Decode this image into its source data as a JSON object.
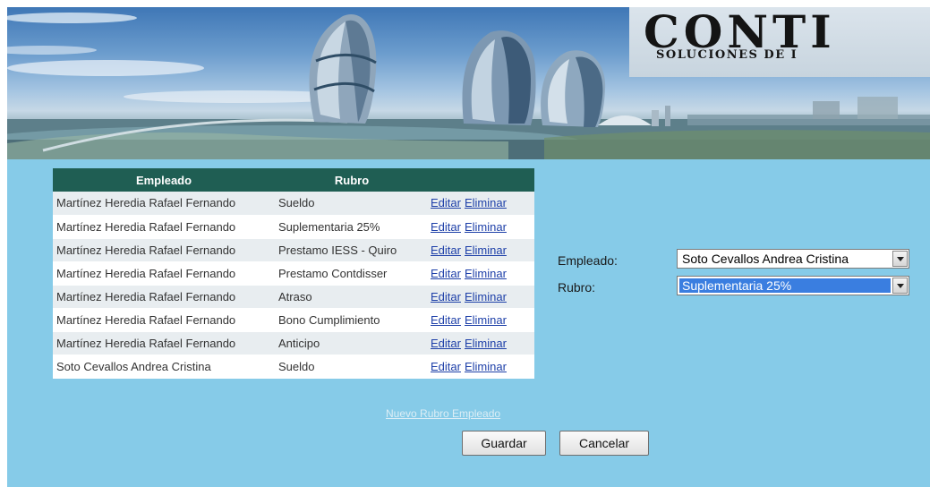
{
  "banner": {
    "logo_word": "CONTI",
    "logo_sub": "SOLUCIONES DE I"
  },
  "grid": {
    "headers": [
      "Empleado",
      "Rubro",
      ""
    ],
    "action_labels": {
      "edit": "Editar",
      "delete": "Eliminar"
    },
    "rows": [
      {
        "empleado": "Martínez Heredia Rafael Fernando",
        "rubro": "Sueldo"
      },
      {
        "empleado": "Martínez Heredia Rafael Fernando",
        "rubro": "Suplementaria 25%"
      },
      {
        "empleado": "Martínez Heredia Rafael Fernando",
        "rubro": "Prestamo IESS - Quiro"
      },
      {
        "empleado": "Martínez Heredia Rafael Fernando",
        "rubro": "Prestamo Contdisser"
      },
      {
        "empleado": "Martínez Heredia Rafael Fernando",
        "rubro": "Atraso"
      },
      {
        "empleado": "Martínez Heredia Rafael Fernando",
        "rubro": "Bono Cumplimiento"
      },
      {
        "empleado": "Martínez Heredia Rafael Fernando",
        "rubro": "Anticipo"
      },
      {
        "empleado": "Soto Cevallos Andrea Cristina",
        "rubro": "Sueldo"
      }
    ],
    "new_link": "Nuevo Rubro Empleado"
  },
  "buttons": {
    "save": "Guardar",
    "cancel": "Cancelar"
  },
  "form": {
    "empleado_label": "Empleado:",
    "empleado_value": "Soto Cevallos Andrea Cristina",
    "rubro_label": "Rubro:",
    "rubro_value": "Suplementaria 25%"
  },
  "colors": {
    "page_background": "#86cbe8",
    "grid_header": "#1f5e53",
    "link": "#1d3fa8",
    "selected_highlight": "#3a7ee0"
  }
}
